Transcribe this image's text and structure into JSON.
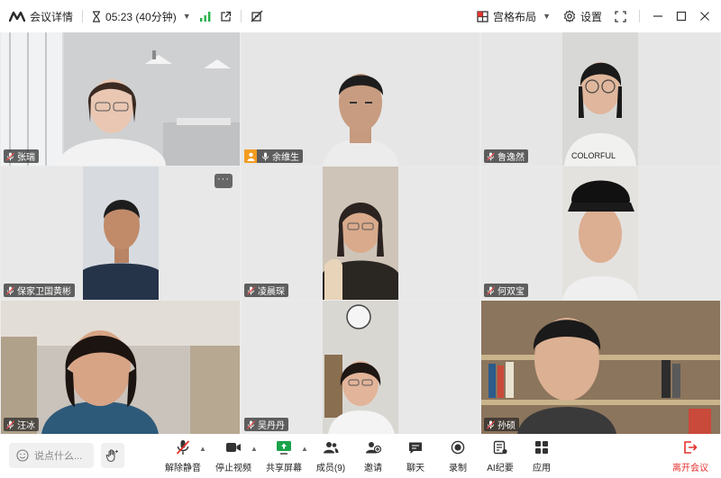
{
  "topbar": {
    "meeting_info_label": "会议详情",
    "timer": "05:23 (40分钟)",
    "layout_label": "宫格布局",
    "settings_label": "设置"
  },
  "participants": [
    {
      "name": "张瑞",
      "host": false
    },
    {
      "name": "余维生",
      "host": true
    },
    {
      "name": "鲁逸然",
      "host": false
    },
    {
      "name": "保家卫国黄彬",
      "host": false
    },
    {
      "name": "凌晨琛",
      "host": false
    },
    {
      "name": "何双宝",
      "host": false
    },
    {
      "name": "汪冰",
      "host": false
    },
    {
      "name": "吴丹丹",
      "host": false
    },
    {
      "name": "孙硕",
      "host": false
    }
  ],
  "tile_more": "···",
  "toolbar": {
    "chat_placeholder": "说点什么...",
    "unmute": "解除静音",
    "stop_video": "停止视频",
    "share_screen": "共享屏幕",
    "members": "成员(9)",
    "invite": "邀请",
    "chat": "聊天",
    "record": "录制",
    "ai_minutes": "AI纪要",
    "apps": "应用",
    "leave": "离开会议"
  },
  "colors": {
    "accent_blue": "#1f6fe5",
    "signal_green": "#25b24a",
    "host_orange": "#f29b1f",
    "leave_red": "#e5322d",
    "share_green": "#1aa34a"
  }
}
